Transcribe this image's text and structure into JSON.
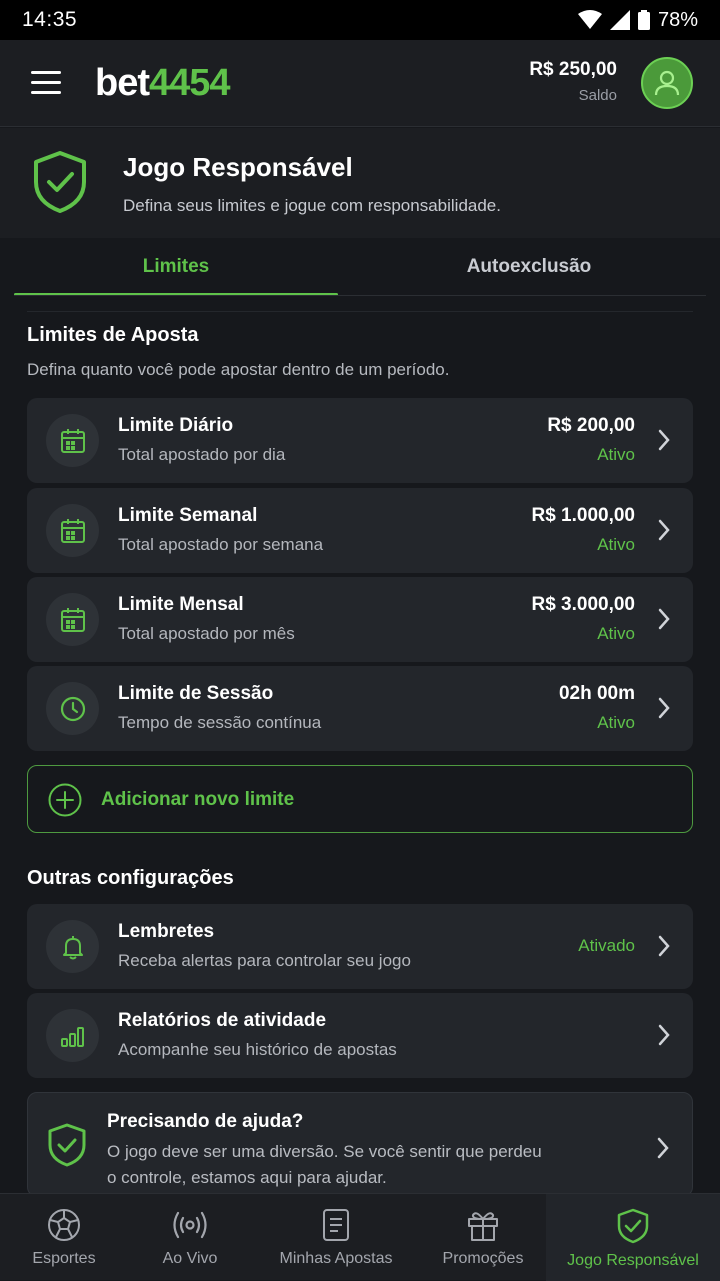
{
  "status_bar": {
    "time": "14:35",
    "battery": "78%"
  },
  "app_bar": {
    "logo_white": "bet",
    "logo_green": "4454",
    "balance_amount": "R$ 250,00",
    "balance_label": "Saldo"
  },
  "hero": {
    "title": "Jogo Responsável",
    "subtitle": "Defina seus limites e jogue com responsabilidade."
  },
  "tabs": [
    {
      "label": "Limites",
      "active": true
    },
    {
      "label": "Autoexclusão",
      "active": false
    }
  ],
  "bet_limits": {
    "title": "Limites de Aposta",
    "subtitle": "Defina quanto você pode apostar dentro de um período.",
    "items": [
      {
        "title": "Limite Diário",
        "sub": "Total apostado por dia",
        "value": "R$ 200,00",
        "status": "Ativo",
        "icon": "calendar-icon"
      },
      {
        "title": "Limite Semanal",
        "sub": "Total apostado por semana",
        "value": "R$ 1.000,00",
        "status": "Ativo",
        "icon": "calendar-icon"
      },
      {
        "title": "Limite Mensal",
        "sub": "Total apostado por mês",
        "value": "R$ 3.000,00",
        "status": "Ativo",
        "icon": "calendar-icon"
      },
      {
        "title": "Limite de Sessão",
        "sub": "Tempo de sessão contínua",
        "value": "02h 00m",
        "status": "Ativo",
        "icon": "clock-icon"
      }
    ],
    "add_label": "Adicionar novo limite"
  },
  "other_settings": {
    "title": "Outras configurações",
    "items": [
      {
        "title": "Lembretes",
        "sub": "Receba alertas para controlar seu jogo",
        "status": "Ativado",
        "icon": "bell-icon"
      },
      {
        "title": "Relatórios de atividade",
        "sub": "Acompanhe seu histórico de apostas",
        "icon": "bar-chart-icon"
      }
    ]
  },
  "help": {
    "title": "Precisando de ajuda?",
    "text": "O jogo deve ser uma diversão. Se você sentir que perdeu o controle, estamos aqui para ajudar."
  },
  "bottom_nav": [
    {
      "label": "Esportes",
      "icon": "soccer-ball-icon",
      "active": false
    },
    {
      "label": "Ao Vivo",
      "icon": "broadcast-icon",
      "active": false
    },
    {
      "label": "Minhas Apostas",
      "icon": "receipt-icon",
      "active": false
    },
    {
      "label": "Promoções",
      "icon": "gift-icon",
      "active": false
    },
    {
      "label": "Jogo Responsável",
      "icon": "shield-check-icon",
      "active": true
    }
  ],
  "colors": {
    "accent": "#5fc24a",
    "background": "#16181c",
    "card": "#23262b"
  }
}
